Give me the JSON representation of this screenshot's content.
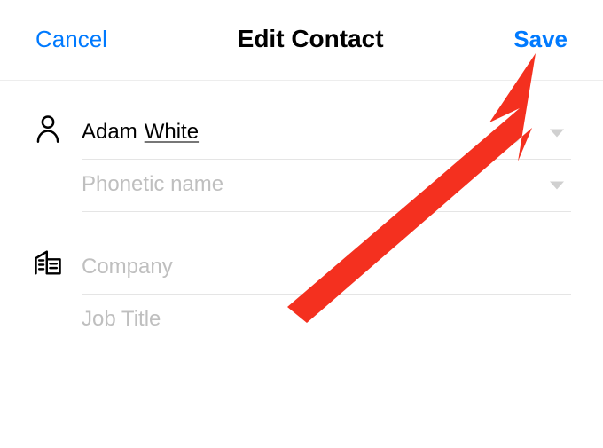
{
  "header": {
    "cancel_label": "Cancel",
    "title": "Edit Contact",
    "save_label": "Save"
  },
  "form": {
    "name": {
      "first": "Adam",
      "last": "White",
      "phonetic_placeholder": "Phonetic name"
    },
    "company_placeholder": "Company",
    "job_title_placeholder": "Job Title"
  },
  "colors": {
    "accent": "#007aff",
    "annotation": "#f4301f"
  }
}
